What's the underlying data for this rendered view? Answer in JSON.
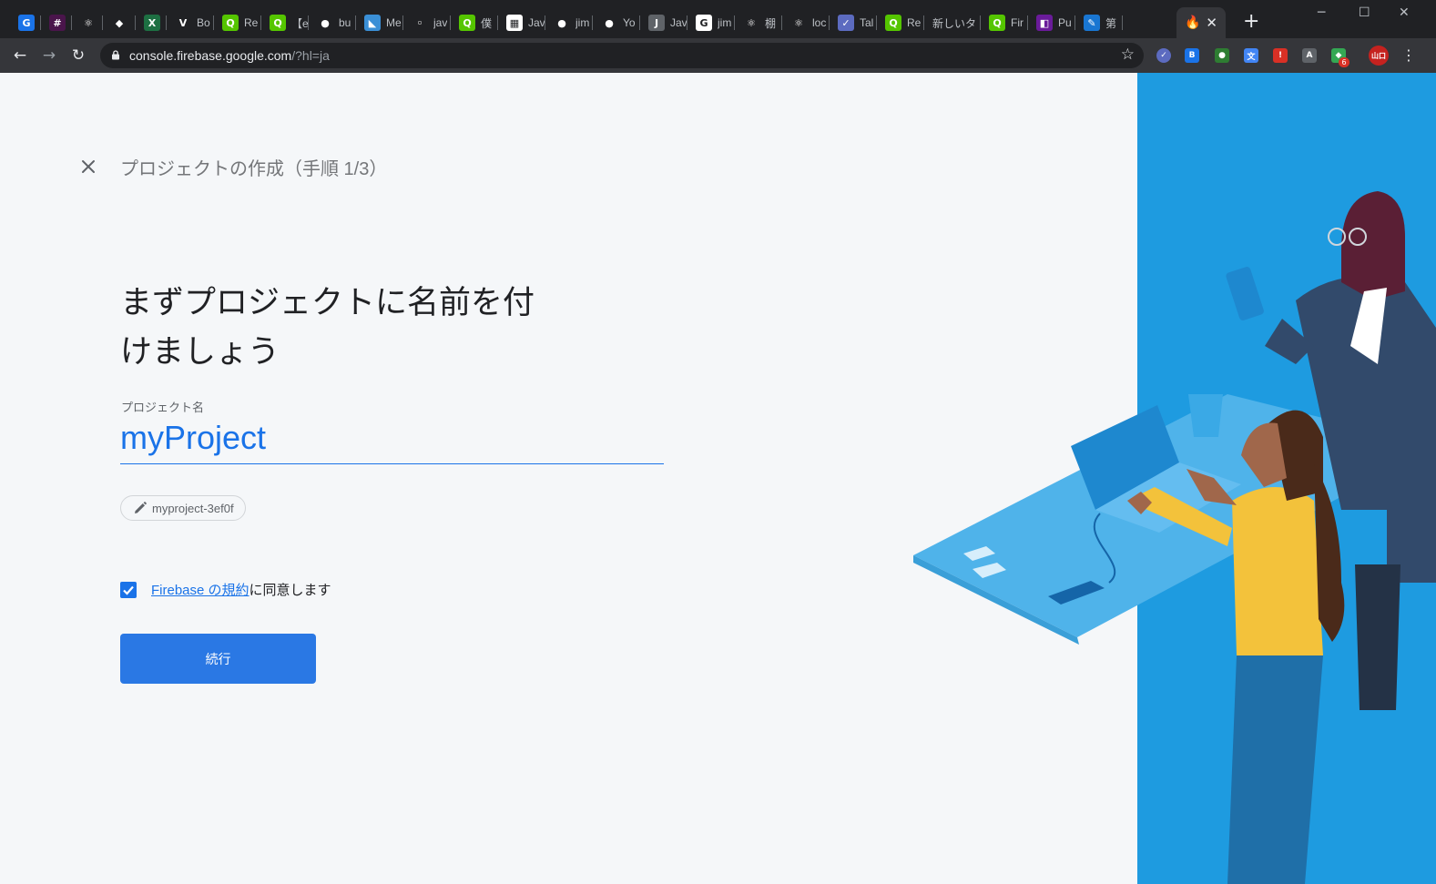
{
  "browser": {
    "tabs": [
      {
        "icon": "google-g-icon",
        "title": "",
        "color": "#1a73e8",
        "glyph": "G"
      },
      {
        "icon": "slack-icon",
        "title": "",
        "color": "#4a154b",
        "glyph": "#"
      },
      {
        "icon": "react-icon",
        "title": "",
        "color": "#202124",
        "glyph": "⚛"
      },
      {
        "icon": "shield-icon",
        "title": "",
        "color": "#202124",
        "glyph": "◆"
      },
      {
        "icon": "excel-icon",
        "title": "",
        "color": "#1d6f42",
        "glyph": "X"
      },
      {
        "icon": "vuetify-icon",
        "title": "Bo",
        "color": "#202124",
        "glyph": "V"
      },
      {
        "icon": "qiita-icon",
        "title": "Re",
        "color": "#55c500",
        "glyph": "Q"
      },
      {
        "icon": "qiita-icon",
        "title": "【el",
        "color": "#55c500",
        "glyph": "Q"
      },
      {
        "icon": "github-icon",
        "title": "bu",
        "color": "#202124",
        "glyph": "●"
      },
      {
        "icon": "medium-icon",
        "title": "Me",
        "color": "#3a8fd6",
        "glyph": "◣"
      },
      {
        "icon": "broadcast-icon",
        "title": "jav",
        "color": "#202124",
        "glyph": "◦"
      },
      {
        "icon": "qiita-icon",
        "title": "僕",
        "color": "#55c500",
        "glyph": "Q"
      },
      {
        "icon": "checker-icon",
        "title": "Jav",
        "color": "#ffffff",
        "glyph": "▦"
      },
      {
        "icon": "github-icon",
        "title": "jim",
        "color": "#202124",
        "glyph": "●"
      },
      {
        "icon": "github-icon",
        "title": "Yo",
        "color": "#202124",
        "glyph": "●"
      },
      {
        "icon": "javadoc-icon",
        "title": "Jav",
        "color": "#5f6368",
        "glyph": "J"
      },
      {
        "icon": "google-icon",
        "title": "jim",
        "color": "#ffffff",
        "glyph": "G"
      },
      {
        "icon": "react-icon",
        "title": "棚",
        "color": "#202124",
        "glyph": "⚛"
      },
      {
        "icon": "react-icon",
        "title": "loc",
        "color": "#202124",
        "glyph": "⚛"
      },
      {
        "icon": "check-circle-icon",
        "title": "Tal",
        "color": "#5c6bc0",
        "glyph": "✓"
      },
      {
        "icon": "qiita-icon",
        "title": "Re",
        "color": "#55c500",
        "glyph": "Q"
      },
      {
        "icon": "none",
        "title": "新しいタ",
        "color": "#202124",
        "glyph": ""
      },
      {
        "icon": "qiita-icon",
        "title": "Fir",
        "color": "#55c500",
        "glyph": "Q"
      },
      {
        "icon": "purple-icon",
        "title": "Pu",
        "color": "#6a1b9a",
        "glyph": "◧"
      },
      {
        "icon": "feather-icon",
        "title": "第",
        "color": "#1976d2",
        "glyph": "✎"
      }
    ],
    "active_tab": {
      "icon": "firebase-icon",
      "title": "",
      "color": "#ffa000"
    },
    "url_host": "console.firebase.google.com",
    "url_path": "/?hl=ja",
    "extensions": [
      {
        "icon": "check-extension-icon",
        "color": "#5c6bc0",
        "glyph": "✓"
      },
      {
        "icon": "blue-extension-icon",
        "color": "#1a73e8",
        "glyph": "B"
      },
      {
        "icon": "robot-extension-icon",
        "color": "#2e7d32",
        "glyph": "●"
      },
      {
        "icon": "translate-extension-icon",
        "color": "#4285f4",
        "glyph": "文"
      },
      {
        "icon": "red-extension-icon",
        "color": "#d93025",
        "glyph": "!"
      },
      {
        "icon": "a-extension-icon",
        "color": "#5f6368",
        "glyph": "A"
      },
      {
        "icon": "green-extension-icon",
        "color": "#34a853",
        "glyph": "◆"
      },
      {
        "icon": "profile-avatar-icon",
        "color": "#c5221f",
        "glyph": "山口"
      }
    ],
    "extension_badge": "6"
  },
  "page": {
    "step_title": "プロジェクトの作成（手順 1/3）",
    "heading_line1": "まずプロジェクトに名前を付",
    "heading_line2": "けましょう",
    "field_label": "プロジェクト名",
    "project_name": "myProject",
    "project_id": "myproject-3ef0f",
    "terms_link": "Firebase の規約",
    "terms_suffix": "に同意します",
    "terms_checked": true,
    "continue_label": "続行"
  },
  "colors": {
    "accent": "#1a73e8",
    "button": "#2a78e4",
    "illustration_bg": "#1e9be0"
  }
}
